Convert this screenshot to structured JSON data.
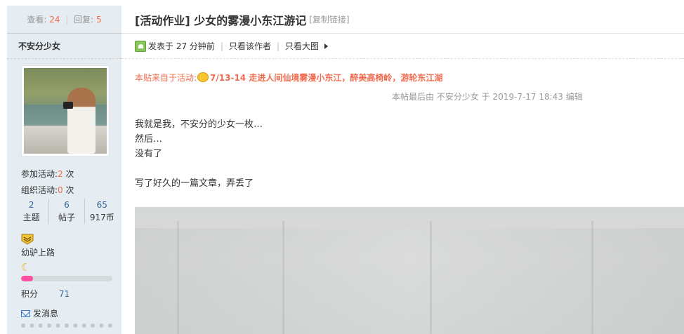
{
  "sidebar": {
    "views_label": "查看:",
    "views": "24",
    "replies_label": "回复:",
    "replies": "5",
    "author": "不安分少女",
    "activities_joined_label": "参加活动:",
    "activities_joined": "2",
    "activities_organized_label": "组织活动:",
    "activities_organized": "0",
    "times_unit": "次",
    "counts": [
      {
        "value": "2",
        "label": "主题"
      },
      {
        "value": "6",
        "label": "帖子"
      },
      {
        "value": "65",
        "label": "917币"
      }
    ],
    "level_name": "幼驴上路",
    "progress_fraction": 0.13,
    "score_label": "积分",
    "score": "71",
    "message_label": "发消息"
  },
  "post": {
    "title": "[活动作业] 少女的雾漫小东江游记",
    "copy_link": "[复制链接]",
    "posted": "发表于 27 分钟前",
    "only_author": "只看该作者",
    "only_images": "只看大图",
    "from_label": "本贴来自于活动:",
    "activity": "7/13-14 走进人间仙境雾漫小东江，醉美高椅岭，游轮东江湖",
    "edited": "本帖最后由 不安分少女 于 2019-7-17 18:43 编辑",
    "lines": [
      "我就是我，不安分的少女一枚…",
      "然后…",
      "没有了",
      "写了好久的一篇文章，弄丢了"
    ]
  },
  "colors": {
    "accent": "#f26c4f",
    "link": "#336699",
    "sidebar_bg": "#e5edf2",
    "progress": "#ff4fa0"
  },
  "icons": [
    "posted-icon",
    "arrow-right-icon",
    "activity-face-icon",
    "medal-icon",
    "moon-icon",
    "envelope-icon"
  ]
}
